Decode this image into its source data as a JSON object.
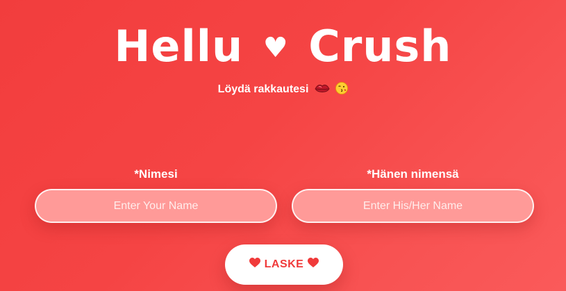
{
  "header": {
    "title_left": "Hellu",
    "title_heart": "♥",
    "title_right": "Crush",
    "subtitle": "Löydä rakkautesi"
  },
  "form": {
    "your_name": {
      "label": "*Nimesi",
      "placeholder": "Enter Your Name",
      "value": ""
    },
    "their_name": {
      "label": "*Hänen nimensä",
      "placeholder": "Enter His/Her Name",
      "value": ""
    },
    "submit_label": "LASKE"
  },
  "icons": {
    "subtitle_icons": [
      "lips-icon",
      "winking-kiss-face-icon"
    ],
    "button_icons": [
      "heart-icon",
      "heart-icon"
    ]
  },
  "colors": {
    "background": "#f54444",
    "accent": "#f03a3a",
    "input_fill": "#ff9a98",
    "text": "#ffffff"
  }
}
